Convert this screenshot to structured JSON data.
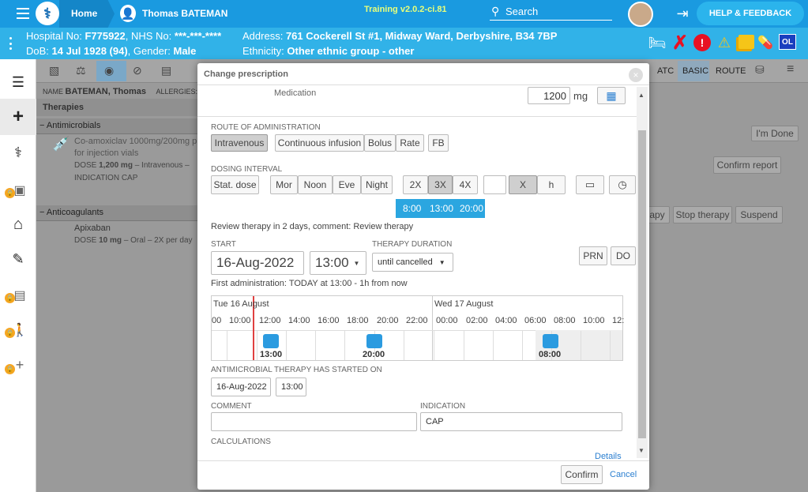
{
  "topbar": {
    "home": "Home",
    "patient_name": "Thomas BATEMAN",
    "training": "Training v2.0.2-ci.81",
    "search": "Search",
    "help": "HELP & FEEDBACK"
  },
  "patient": {
    "hospital_label": "Hospital No:",
    "hospital_no": "F775922",
    "nhs_label": ", NHS No:",
    "nhs_no": "***-***-****",
    "address_label": "Address:",
    "address": "761 Cockerell St #1, Midway Ward, Derbyshire, B34 7BP",
    "dob_label": "DoB:",
    "dob": "14 Jul 1928 (94)",
    "gender_label": ", Gender:",
    "gender": "Male",
    "ethnicity_label": "Ethnicity:",
    "ethnicity": "Other ethnic group - other",
    "ol_badge": "OL"
  },
  "bg": {
    "name_label": "NAME",
    "name": "BATEMAN, Thomas",
    "allergies_label": "ALLERGIES:",
    "therapies": "Therapies",
    "antimicrobials": "Antimicrobials",
    "drug1": "Co-amoxiclav 1000mg/200mg p",
    "drug1b": "for injection vials",
    "drug1_dose_label": "DOSE",
    "drug1_dose": "1,200 mg",
    "drug1_route": "– Intravenous –",
    "drug1_ind_label": "INDICATION",
    "drug1_ind": "CAP",
    "anticoagulants": "Anticoagulants",
    "drug2": "Apixaban",
    "drug2_dose_label": "DOSE",
    "drug2_dose": "10 mg",
    "drug2_route": "– Oral – 2X per day",
    "tabs": [
      "ATC",
      "BASIC",
      "ROUTE"
    ],
    "im_done": "I'm Done",
    "confirm_report": "Confirm report",
    "therapy_btn": "apy",
    "stop_therapy": "Stop therapy",
    "suspend": "Suspend"
  },
  "modal": {
    "title": "Change prescription",
    "medication": "Medication",
    "dose_value": "1200",
    "dose_unit": "mg",
    "route_label": "ROUTE OF ADMINISTRATION",
    "routes": [
      "Intravenous",
      "Continuous infusion",
      "Bolus",
      "Rate",
      "FB"
    ],
    "dosing_label": "DOSING INTERVAL",
    "stat": "Stat. dose",
    "times": [
      "Mor",
      "Noon",
      "Eve",
      "Night"
    ],
    "freq": [
      "2X",
      "3X",
      "4X"
    ],
    "x": "X",
    "h": "h",
    "dose_times": [
      "8:00",
      "13:00",
      "20:00"
    ],
    "review": "Review therapy in 2 days, comment: Review therapy",
    "start_label": "START",
    "start_date": "16-Aug-2022",
    "start_time": "13:00",
    "duration_label": "THERAPY DURATION",
    "duration": "until cancelled",
    "prn": "PRN",
    "do": "DO",
    "first_admin": "First administration: TODAY at 13:00 - 1h from now",
    "day1": "Tue 16 August",
    "day2": "Wed 17 August",
    "hours": [
      "00",
      "10:00",
      "12:00",
      "14:00",
      "16:00",
      "18:00",
      "20:00",
      "22:00",
      "00:00",
      "02:00",
      "04:00",
      "06:00",
      "08:00",
      "10:00",
      "12:"
    ],
    "marks": [
      "13:00",
      "20:00",
      "08:00"
    ],
    "antimicro_label": "ANTIMICROBIAL THERAPY HAS STARTED ON",
    "am_date": "16-Aug-2022",
    "am_time": "13:00",
    "comment_label": "COMMENT",
    "indication_label": "INDICATION",
    "indication": "CAP",
    "calc_label": "CALCULATIONS",
    "details": "Details",
    "confirm": "Confirm",
    "cancel": "Cancel"
  }
}
